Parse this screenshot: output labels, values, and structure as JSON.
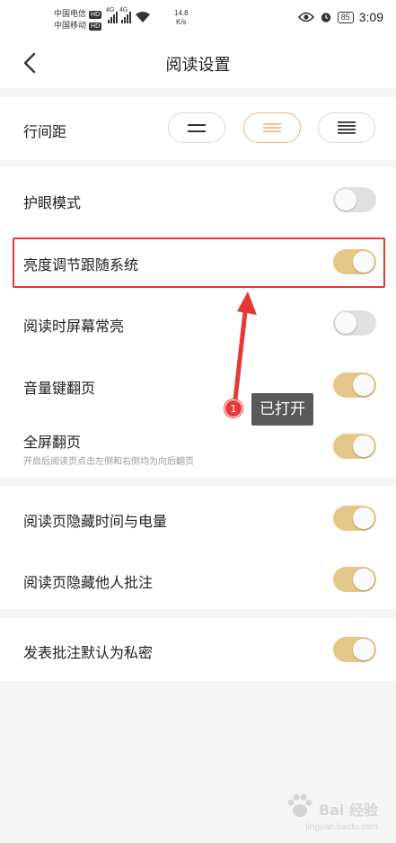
{
  "status_bar": {
    "carrier_1": "中国电信",
    "carrier_2": "中国移动",
    "hd": "HD",
    "signal_label": "4G",
    "speed_value": "14.8",
    "speed_unit": "K/s",
    "battery": "85",
    "time": "3:09"
  },
  "header": {
    "title": "阅读设置",
    "back_icon": "chevron-left-icon"
  },
  "line_spacing": {
    "label": "行间距",
    "options": [
      "small",
      "medium",
      "large"
    ],
    "selected_index": 1,
    "accent_color": "#e0bb7c"
  },
  "settings_group_1": [
    {
      "label": "护眼模式",
      "enabled": false
    },
    {
      "label": "亮度调节跟随系统",
      "enabled": true
    },
    {
      "label": "阅读时屏幕常亮",
      "enabled": false
    },
    {
      "label": "音量键翻页",
      "enabled": true
    },
    {
      "label": "全屏翻页",
      "sublabel": "开启后阅读页点击左侧和右侧均为向后翻页",
      "enabled": true
    }
  ],
  "settings_group_2": [
    {
      "label": "阅读页隐藏时间与电量",
      "enabled": true
    },
    {
      "label": "阅读页隐藏他人批注",
      "enabled": true
    }
  ],
  "settings_group_3": [
    {
      "label": "发表批注默认为私密",
      "enabled": true
    }
  ],
  "annotation": {
    "step_number": "1",
    "callout_text": "已打开",
    "color": "#e53935"
  },
  "colors": {
    "toggle_on": "#e6c78a",
    "toggle_off": "#e0e0e0",
    "background": "#f5f5f5"
  },
  "watermark": {
    "text": "Bai 经验",
    "url": "jingyan.baidu.com"
  }
}
